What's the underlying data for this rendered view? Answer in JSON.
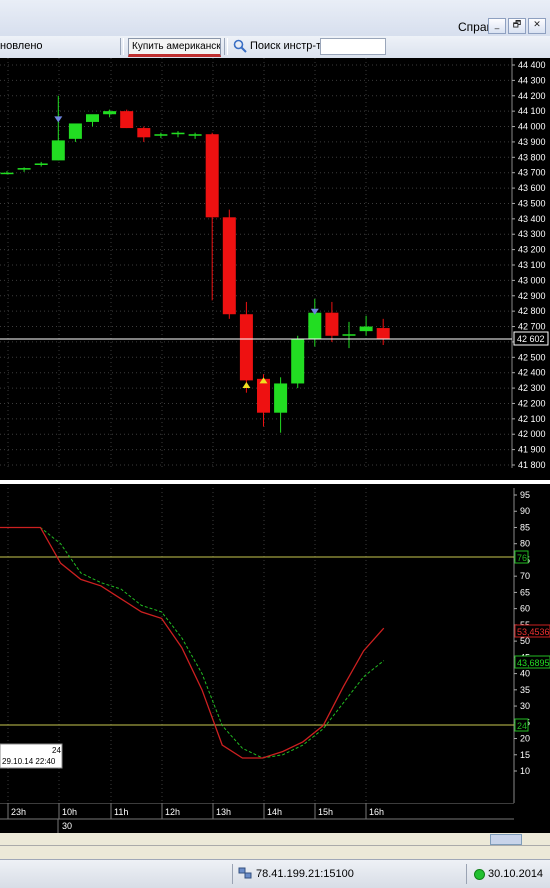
{
  "menubar": {
    "help": "Справка",
    "minimize_glyph": "_",
    "restore_glyph": "🗗",
    "close_glyph": "✕"
  },
  "toolbar": {
    "status": "новлено",
    "buy_american": "Купить американск»",
    "search_label": "Поиск инстр-та",
    "search_value": ""
  },
  "price_axis": {
    "labels": [
      "44 400",
      "44 300",
      "44 200",
      "44 100",
      "44 000",
      "43 900",
      "43 800",
      "43 700",
      "43 600",
      "43 500",
      "43 400",
      "43 300",
      "43 200",
      "43 100",
      "43 000",
      "42 900",
      "42 800",
      "42 700",
      "42 600",
      "42 500",
      "42 400",
      "42 300",
      "42 200",
      "42 100",
      "42 000",
      "41 900",
      "41 800"
    ],
    "current_price": "42 602"
  },
  "osc_axis": {
    "labels": [
      "95",
      "90",
      "85",
      "80",
      "75",
      "70",
      "65",
      "60",
      "55",
      "50",
      "45",
      "40",
      "35",
      "30",
      "25",
      "20",
      "15",
      "10"
    ],
    "upper_level": "76",
    "lower_level": "24",
    "red_value": "53,4536",
    "green_value": "43,6895"
  },
  "tooltip": {
    "value": "24",
    "datetime": "29.10.14 22:40"
  },
  "time_axis": {
    "labels": [
      "23h",
      "10h",
      "11h",
      "12h",
      "13h",
      "14h",
      "15h",
      "16h"
    ],
    "date_label": "30"
  },
  "statusbar": {
    "server": "78.41.199.21:15100",
    "date": "30.10.2014"
  },
  "colors": {
    "up": "#22dd22",
    "down": "#ee1111",
    "signal_line": "#cc2020",
    "signal_dashed": "#22bb22",
    "level": "#c8c850"
  },
  "chart_data": [
    {
      "type": "candlestick",
      "title": "",
      "ylim": [
        41800,
        44400
      ],
      "current_price": 42602,
      "candles": [
        {
          "o": 43700,
          "h": 43710,
          "l": 43690,
          "c": 43700
        },
        {
          "o": 43720,
          "h": 43735,
          "l": 43705,
          "c": 43730
        },
        {
          "o": 43750,
          "h": 43770,
          "l": 43740,
          "c": 43760
        },
        {
          "o": 43780,
          "h": 44200,
          "l": 43780,
          "c": 43910
        },
        {
          "o": 43920,
          "h": 44010,
          "l": 43900,
          "c": 44020
        },
        {
          "o": 44030,
          "h": 44060,
          "l": 44000,
          "c": 44080
        },
        {
          "o": 44080,
          "h": 44110,
          "l": 44060,
          "c": 44100
        },
        {
          "o": 44100,
          "h": 44110,
          "l": 43990,
          "c": 43990
        },
        {
          "o": 43990,
          "h": 44000,
          "l": 43900,
          "c": 43930
        },
        {
          "o": 43940,
          "h": 43960,
          "l": 43925,
          "c": 43950
        },
        {
          "o": 43950,
          "h": 43970,
          "l": 43930,
          "c": 43960
        },
        {
          "o": 43940,
          "h": 43960,
          "l": 43920,
          "c": 43950
        },
        {
          "o": 43950,
          "h": 43960,
          "l": 42870,
          "c": 43410
        },
        {
          "o": 43410,
          "h": 43460,
          "l": 42750,
          "c": 42780
        },
        {
          "o": 42780,
          "h": 42860,
          "l": 42270,
          "c": 42350
        },
        {
          "o": 42360,
          "h": 42390,
          "l": 42050,
          "c": 42140
        },
        {
          "o": 42140,
          "h": 42370,
          "l": 42010,
          "c": 42330
        },
        {
          "o": 42330,
          "h": 42640,
          "l": 42300,
          "c": 42620
        },
        {
          "o": 42620,
          "h": 42880,
          "l": 42570,
          "c": 42790
        },
        {
          "o": 42790,
          "h": 42860,
          "l": 42600,
          "c": 42640
        },
        {
          "o": 42640,
          "h": 42730,
          "l": 42560,
          "c": 42650
        },
        {
          "o": 42670,
          "h": 42770,
          "l": 42640,
          "c": 42700
        },
        {
          "o": 42690,
          "h": 42750,
          "l": 42580,
          "c": 42620
        }
      ],
      "signals": [
        {
          "index": 3,
          "type": "sell",
          "price": 44040
        },
        {
          "index": 14,
          "type": "buy",
          "price": 42320
        },
        {
          "index": 15,
          "type": "buy",
          "price": 42350
        },
        {
          "index": 18,
          "type": "sell",
          "price": 42790
        }
      ]
    },
    {
      "type": "line",
      "ylim": [
        8,
        96
      ],
      "levels": [
        76,
        24
      ],
      "series": [
        {
          "values": [
            85,
            85,
            85,
            74,
            69,
            67,
            63,
            59,
            57,
            48,
            35,
            18,
            14,
            14,
            16,
            19,
            24,
            36,
            47,
            54
          ]
        },
        {
          "values": [
            85,
            85,
            85,
            80,
            71,
            68,
            66,
            61,
            59,
            51,
            40,
            24,
            17,
            14,
            15,
            18,
            23,
            31,
            39,
            44
          ]
        }
      ]
    }
  ]
}
